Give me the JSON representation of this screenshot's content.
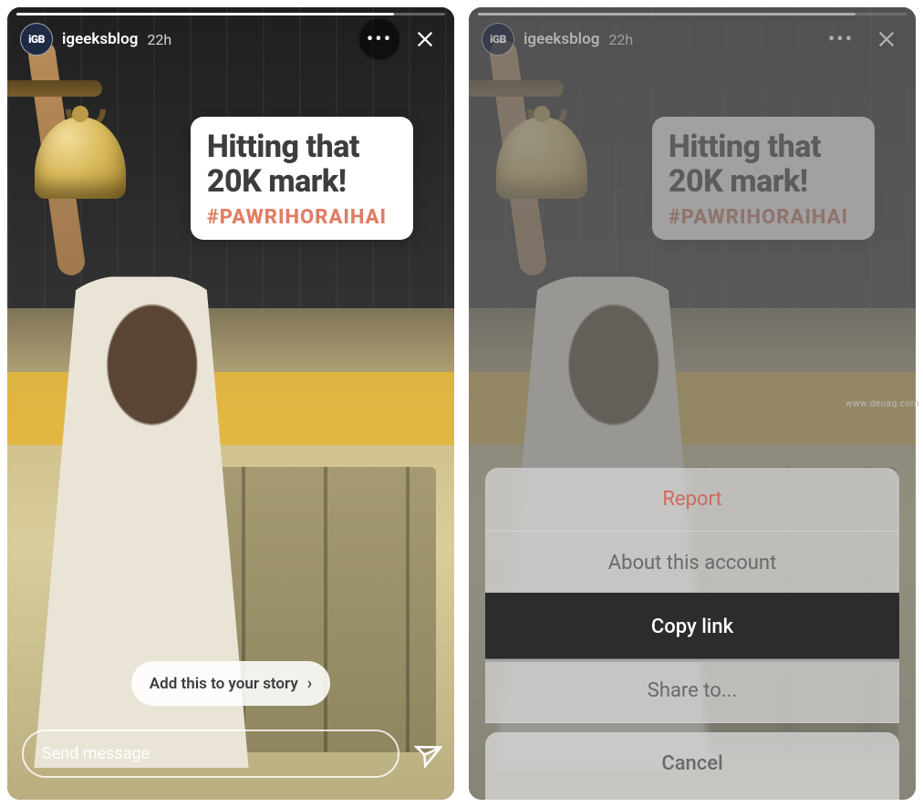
{
  "story": {
    "username": "igeeksblog",
    "avatar_text": "iGB",
    "time": "22h",
    "headline_line1": "Hitting that",
    "headline_line2": "20K mark!",
    "hashtag": "#PAWRIHORAIHAI",
    "add_to_story_label": "Add this to your story",
    "message_placeholder": "Send message"
  },
  "action_sheet": {
    "report": "Report",
    "about": "About this account",
    "copy_link": "Copy link",
    "share_to": "Share to...",
    "cancel": "Cancel"
  },
  "watermark": "www.deuaq.com"
}
